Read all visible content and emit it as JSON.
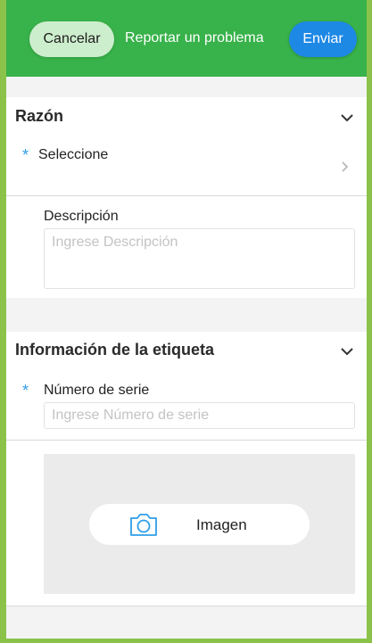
{
  "header": {
    "cancel_label": "Cancelar",
    "title": "Reportar un problema",
    "send_label": "Enviar"
  },
  "reason_section": {
    "title": "Razón",
    "required_mark": "*",
    "select_label": "Seleccione",
    "description_label": "Descripción",
    "description_placeholder": "Ingrese Descripción"
  },
  "tag_section": {
    "title": "Información de la etiqueta",
    "required_mark": "*",
    "serial_label": "Número de serie",
    "serial_placeholder": "Ingrese Número de serie",
    "image_label": "Imagen"
  },
  "colors": {
    "header_green": "#38b24a",
    "accent_blue": "#1e88e5",
    "required_blue": "#2f9ee8",
    "frame_green": "#8bc34a"
  },
  "icons": [
    "chevron-down-icon",
    "chevron-right-icon",
    "camera-icon"
  ]
}
